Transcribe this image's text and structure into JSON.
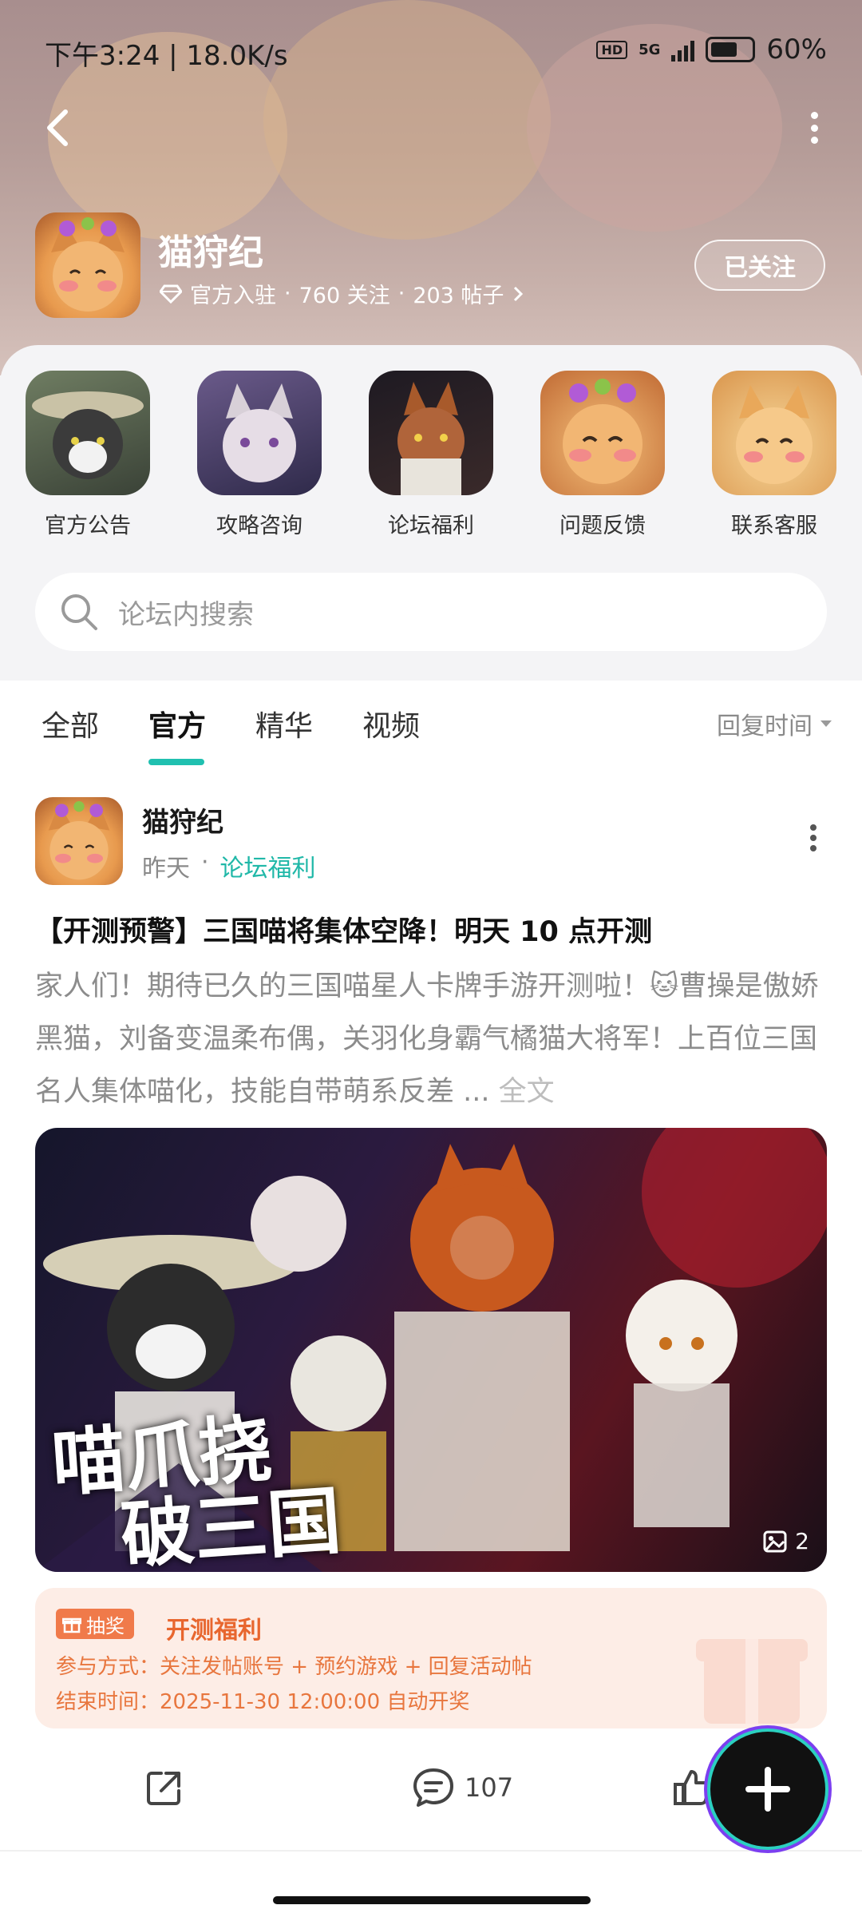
{
  "status_bar": {
    "time_speed": "下午3:24 | 18.0K/s",
    "hd": "HD",
    "network": "5G",
    "battery": "60%"
  },
  "forum": {
    "title": "猫狩纪",
    "meta": {
      "badge": "官方入驻",
      "follows": "760 关注",
      "posts": "203 帖子"
    },
    "follow_button": "已关注"
  },
  "quick_links": [
    {
      "label": "官方公告"
    },
    {
      "label": "攻略咨询"
    },
    {
      "label": "论坛福利"
    },
    {
      "label": "问题反馈"
    },
    {
      "label": "联系客服"
    }
  ],
  "search": {
    "placeholder": "论坛内搜索"
  },
  "tabs": {
    "all": "全部",
    "official": "官方",
    "featured": "精华",
    "video": "视频",
    "sort": "回复时间"
  },
  "post": {
    "author": "猫狩纪",
    "time": "昨天",
    "board": "论坛福利",
    "title": "【开测预警】三国喵将集体空降！明天 10 点开测",
    "body": "家人们！期待已久的三国喵星人卡牌手游开测啦！🐱曹操是傲娇黑猫，刘备变温柔布偶，关羽化身霸气橘猫大将军！上百位三国名人集体喵化，技能自带萌系反差 ...",
    "read_more": "全文",
    "image_title_line1": "喵爪挠",
    "image_title_line2": "破三国",
    "image_count": "2",
    "prize": {
      "tag": "抽奖",
      "title": "开测福利",
      "join": "参与方式：关注发帖账号 + 预约游戏 + 回复活动帖",
      "end": "结束时间：2025-11-30 12:00:00 自动开奖"
    },
    "comment_count": "107"
  },
  "colors": {
    "accent": "#20c0b0",
    "prize_orange": "#e8662e",
    "prize_bg": "#fdede6"
  }
}
